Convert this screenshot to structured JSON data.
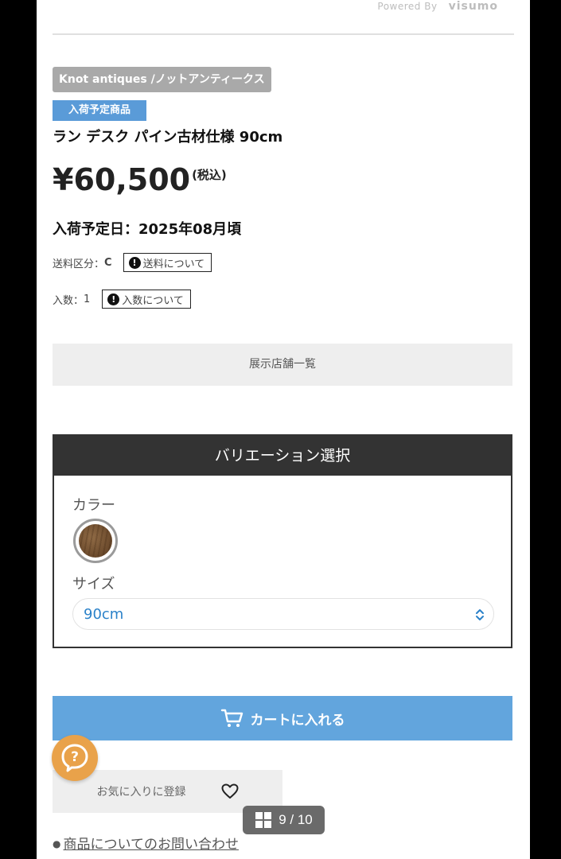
{
  "header": {
    "powered_by": "Powered By",
    "powered_brand": "visumo"
  },
  "product": {
    "brand": "Knot antiques /ノットアンティークス",
    "status_tag": "入荷予定商品",
    "title": "ラン デスク パイン古材仕様 90cm",
    "price": "¥60,500",
    "tax_note": "(税込)",
    "arrival_date": "入荷予定日：2025年08月頃",
    "shipping_label": "送料区分：",
    "shipping_class": "C",
    "shipping_info_button": "送料について",
    "quantity_label": "入数：",
    "quantity_value": "1",
    "quantity_info_button": "入数について"
  },
  "store_list_button": "展示店舗一覧",
  "variation": {
    "heading": "バリエーション選択",
    "color_label": "カラー",
    "size_label": "サイズ",
    "size_selected": "90cm"
  },
  "actions": {
    "cart_button": "カートに入れる",
    "favorite_button": "お気に入りに登録",
    "help_button": "?"
  },
  "pager": {
    "label": "9 / 10"
  },
  "footer": {
    "contact_link": "商品についてのお問い合わせ"
  },
  "colors": {
    "accent_blue": "#62a5dd",
    "status_blue": "#5a9bd8",
    "help_orange": "#e9a24a",
    "variation_header": "#333333"
  },
  "icons": [
    "exclamation-icon",
    "wood-swatch",
    "select-arrows-icon",
    "cart-icon",
    "heart-icon",
    "help-icon",
    "grid-icon"
  ]
}
